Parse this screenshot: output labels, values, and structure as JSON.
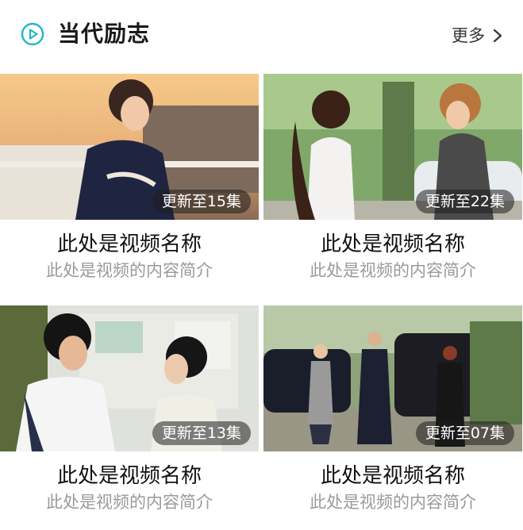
{
  "header": {
    "icon": "play-circle-icon",
    "title": "当代励志",
    "more_label": "更多",
    "more_icon": "chevron-right-icon",
    "accent_color": "#1fb6c9"
  },
  "cards": [
    {
      "title": "此处是视频名称",
      "desc": "此处是视频的内容简介",
      "badge": "更新至15集"
    },
    {
      "title": "此处是视频名称",
      "desc": "此处是视频的内容简介",
      "badge": "更新至22集"
    },
    {
      "title": "此处是视频名称",
      "desc": "此处是视频的内容简介",
      "badge": "更新至13集"
    },
    {
      "title": "此处是视频名称",
      "desc": "此处是视频的内容简介",
      "badge": "更新至07集"
    }
  ]
}
